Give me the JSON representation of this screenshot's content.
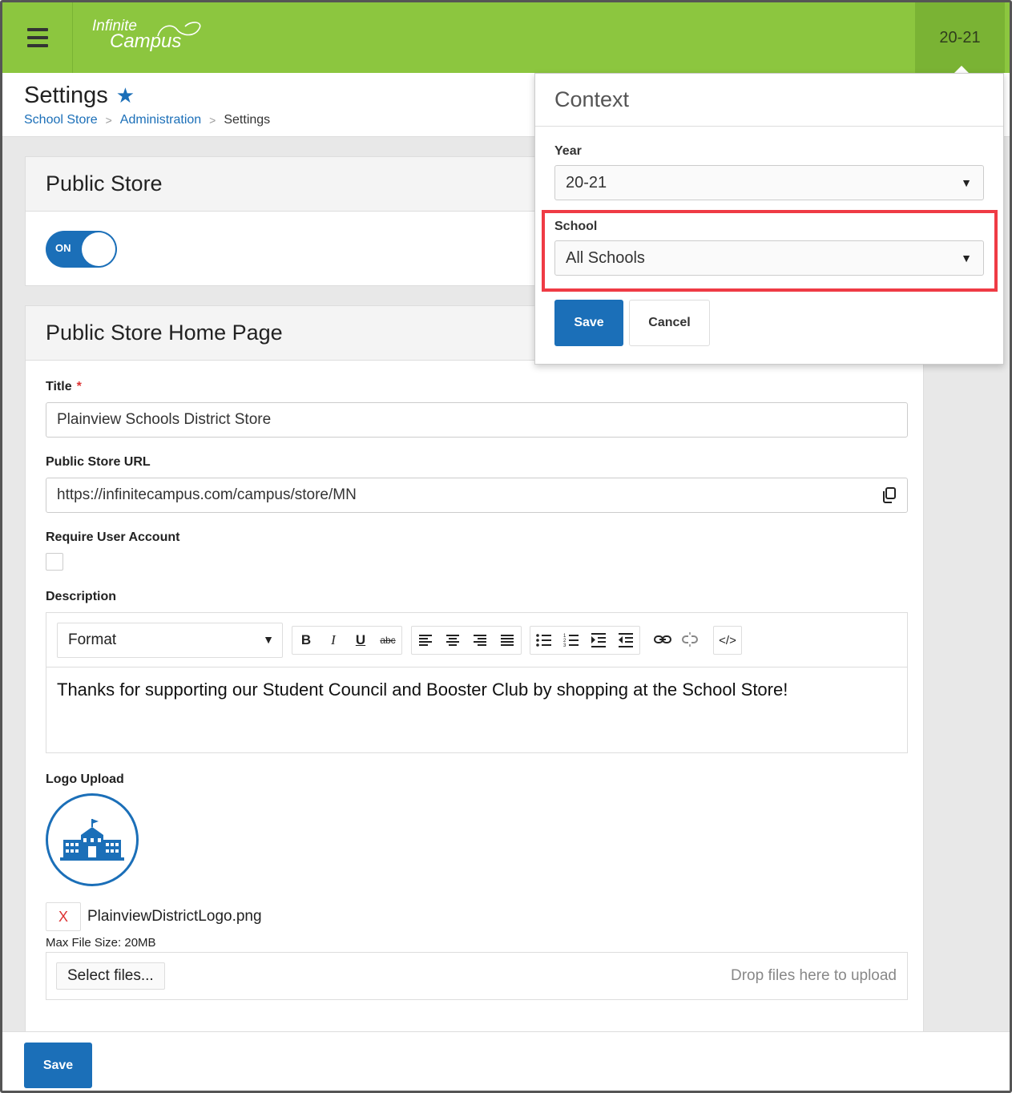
{
  "topbar": {
    "logo_line1": "Infinite",
    "logo_line2": "Campus",
    "year": "20-21"
  },
  "header": {
    "title": "Settings",
    "breadcrumb": [
      "School Store",
      "Administration",
      "Settings"
    ]
  },
  "public_store": {
    "heading": "Public Store",
    "toggle_label": "ON",
    "toggle_state": true
  },
  "home_page": {
    "heading": "Public Store Home Page",
    "title_label": "Title",
    "required_mark": "*",
    "title_value": "Plainview Schools District Store",
    "url_label": "Public Store URL",
    "url_value": "https://infinitecampus.com/campus/store/MN",
    "require_account_label": "Require User Account",
    "require_account_checked": false,
    "description_label": "Description",
    "format_value": "Format",
    "toolbar_buttons": [
      "bold",
      "italic",
      "underline",
      "strikethrough",
      "align-left",
      "align-center",
      "align-right",
      "justify",
      "bullet-list",
      "numbered-list",
      "indent",
      "outdent",
      "link",
      "unlink",
      "view-html"
    ],
    "bold_glyph": "B",
    "italic_glyph": "I",
    "underline_glyph": "U",
    "strike_glyph": "abc",
    "html_glyph": "</>",
    "description_text": "Thanks for supporting our Student Council and Booster Club by shopping at the School Store!",
    "logo_label": "Logo Upload",
    "remove_glyph": "X",
    "file_name": "PlainviewDistrictLogo.png",
    "max_file_size": "Max File Size: 20MB",
    "select_files": "Select files...",
    "drop_text": "Drop files here to upload"
  },
  "footer": {
    "save": "Save"
  },
  "context_popup": {
    "title": "Context",
    "year_label": "Year",
    "year_value": "20-21",
    "school_label": "School",
    "school_value": "All Schools",
    "save": "Save",
    "cancel": "Cancel"
  },
  "colors": {
    "topbar": "#8cc63f",
    "accent": "#1b6fb8",
    "highlight": "#ef3b45"
  }
}
